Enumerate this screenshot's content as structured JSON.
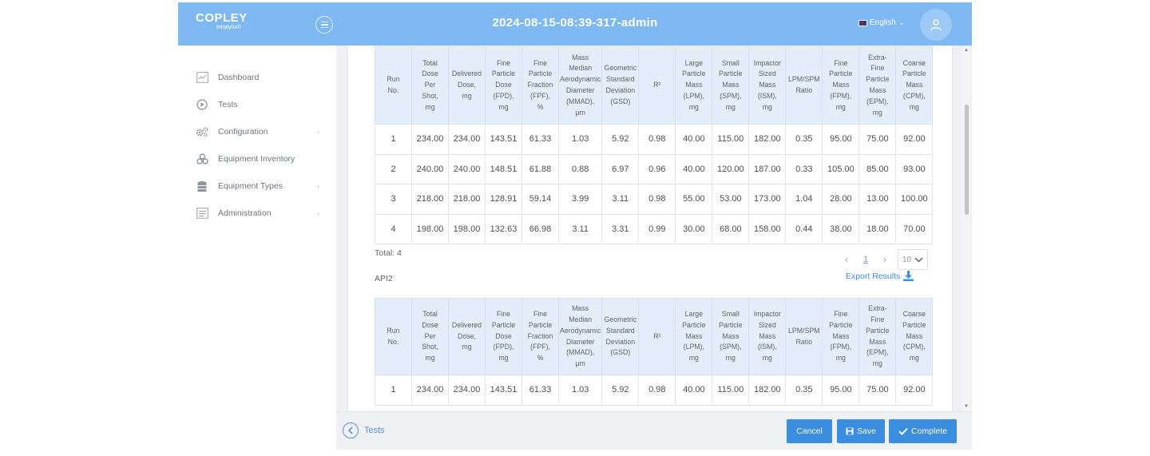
{
  "header": {
    "logo_main": "COPLEY",
    "logo_sub": "Inhalytix®",
    "title": "2024-08-15-08:39-317-admin",
    "language": "English"
  },
  "sidebar": {
    "items": [
      {
        "label": "Dashboard",
        "icon": "chart-icon",
        "has_submenu": false
      },
      {
        "label": "Tests",
        "icon": "play-icon",
        "has_submenu": false
      },
      {
        "label": "Configuration",
        "icon": "gears-icon",
        "has_submenu": true
      },
      {
        "label": "Equipment Inventory",
        "icon": "cubes-icon",
        "has_submenu": false
      },
      {
        "label": "Equipment Types",
        "icon": "stack-icon",
        "has_submenu": true
      },
      {
        "label": "Administration",
        "icon": "admin-icon",
        "has_submenu": true
      }
    ]
  },
  "table": {
    "columns": [
      [
        "Run",
        "No."
      ],
      [
        "Total",
        "Dose",
        "Per",
        "Shot,",
        "mg"
      ],
      [
        "Delivered",
        "Dose,",
        "mg"
      ],
      [
        "Fine",
        "Particle",
        "Dose",
        "(FPD),",
        "mg"
      ],
      [
        "Fine",
        "Particle",
        "Fraction",
        "(FPF),",
        "%"
      ],
      [
        "Mass",
        "Median",
        "Aerodynamic",
        "Diameter",
        "(MMAD),",
        "μm"
      ],
      [
        "Geometric",
        "Standard",
        "Deviation",
        "(GSD)"
      ],
      [
        "R²"
      ],
      [
        "Large",
        "Particle",
        "Mass",
        "(LPM),",
        "mg"
      ],
      [
        "Small",
        "Particle",
        "Mass",
        "(SPM),",
        "mg"
      ],
      [
        "Impactor",
        "Sized",
        "Mass",
        "(ISM),",
        "mg"
      ],
      [
        "LPM/SPM",
        "Ratio"
      ],
      [
        "Fine",
        "Particle",
        "Mass",
        "(FPM),",
        "mg"
      ],
      [
        "Extra-",
        "Fine",
        "Particle",
        "Mass",
        "(EPM),",
        "mg"
      ],
      [
        "Coarse",
        "Particle",
        "Mass",
        "(CPM),",
        "mg"
      ]
    ]
  },
  "section1": {
    "rows": [
      [
        "1",
        "234.00",
        "234.00",
        "143.51",
        "61.33",
        "1.03",
        "5.92",
        "0.98",
        "40.00",
        "115.00",
        "182.00",
        "0.35",
        "95.00",
        "75.00",
        "92.00"
      ],
      [
        "2",
        "240.00",
        "240.00",
        "148.51",
        "61.88",
        "0.88",
        "6.97",
        "0.96",
        "40.00",
        "120.00",
        "187.00",
        "0.33",
        "105.00",
        "85.00",
        "93.00"
      ],
      [
        "3",
        "218.00",
        "218.00",
        "128.91",
        "59.14",
        "3.99",
        "3.11",
        "0.98",
        "55.00",
        "53.00",
        "173.00",
        "1.04",
        "28.00",
        "13.00",
        "100.00"
      ],
      [
        "4",
        "198.00",
        "198.00",
        "132.63",
        "66.98",
        "3.11",
        "3.31",
        "0.99",
        "30.00",
        "68.00",
        "158.00",
        "0.44",
        "38.00",
        "18.00",
        "70.00"
      ]
    ],
    "total_label": "Total: 4",
    "page": "1",
    "page_size": "10"
  },
  "section2": {
    "name": "API2",
    "export_label": "Export Results",
    "rows": [
      [
        "1",
        "234.00",
        "234.00",
        "143.51",
        "61.33",
        "1.03",
        "5.92",
        "0.98",
        "40.00",
        "115.00",
        "182.00",
        "0.35",
        "95.00",
        "75.00",
        "92.00"
      ]
    ]
  },
  "footer": {
    "back_label": "Tests",
    "cancel_label": "Cancel",
    "save_label": "Save",
    "complete_label": "Complete"
  },
  "colors": {
    "header": "#7eb8f2",
    "primary": "#3b8de0",
    "table_header": "#e3eefa"
  }
}
